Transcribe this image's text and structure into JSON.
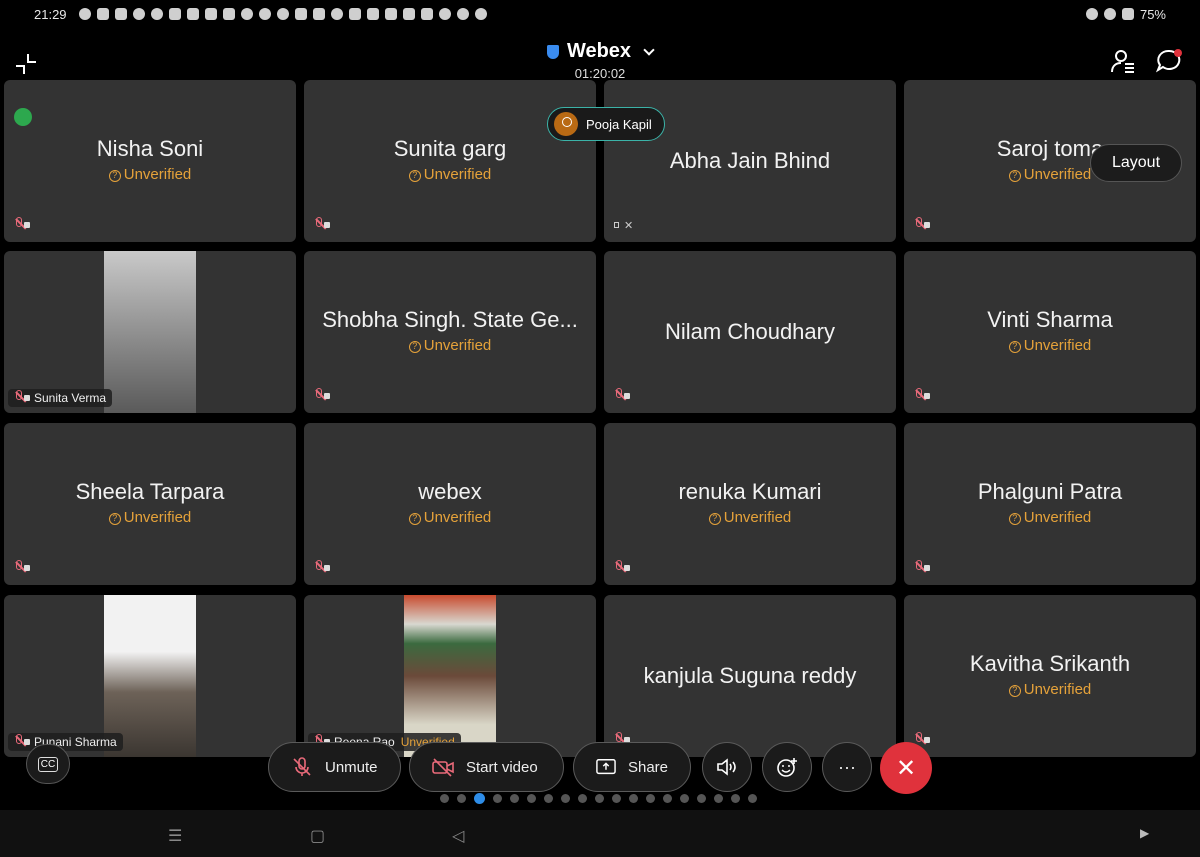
{
  "status_bar": {
    "time": "21:29",
    "battery": "75%"
  },
  "header": {
    "title": "Webex",
    "timer": "01:20:02"
  },
  "active_speaker": "Pooja Kapil",
  "layout_button": "Layout",
  "unverified_label": "Unverified",
  "tiles": [
    {
      "name": "Nisha Soni",
      "unverified": true,
      "audio": "muted",
      "signal": true
    },
    {
      "name": "Sunita garg",
      "unverified": true,
      "audio": "muted"
    },
    {
      "name": "Abha Jain Bhind",
      "unverified": false,
      "audio": "speaker-muted"
    },
    {
      "name": "Saroj toma",
      "unverified": true,
      "audio": "muted"
    },
    {
      "name": "Sunita Verma",
      "video": true,
      "audio": "muted"
    },
    {
      "name": "Shobha Singh. State Ge...",
      "unverified": true,
      "audio": "muted"
    },
    {
      "name": "Nilam Choudhary",
      "unverified": false,
      "audio": "muted"
    },
    {
      "name": "Vinti Sharma",
      "unverified": true,
      "audio": "muted"
    },
    {
      "name": "Sheela Tarpara",
      "unverified": true,
      "audio": "muted"
    },
    {
      "name": "webex",
      "unverified": true,
      "audio": "muted"
    },
    {
      "name": "renuka Kumari",
      "unverified": true,
      "audio": "muted"
    },
    {
      "name": "Phalguni Patra",
      "unverified": true,
      "audio": "muted"
    },
    {
      "name": "Punani Sharma",
      "video": true,
      "audio": "muted"
    },
    {
      "name": "Reena Rao",
      "video": true,
      "audio": "muted",
      "chip_unverified": "Unverified"
    },
    {
      "name": "kanjula Suguna reddy",
      "unverified": false,
      "audio": "muted"
    },
    {
      "name": "Kavitha Srikanth",
      "unverified": true,
      "audio": "muted"
    }
  ],
  "controls": {
    "unmute": "Unmute",
    "start_video": "Start video",
    "share": "Share",
    "cc": "CC",
    "more": "···"
  },
  "colors": {
    "unverified": "#e5a23a",
    "end_call": "#e0323c",
    "active_dot": "#2e8de8"
  },
  "page_dots": {
    "count": 19,
    "active_index": 2
  }
}
